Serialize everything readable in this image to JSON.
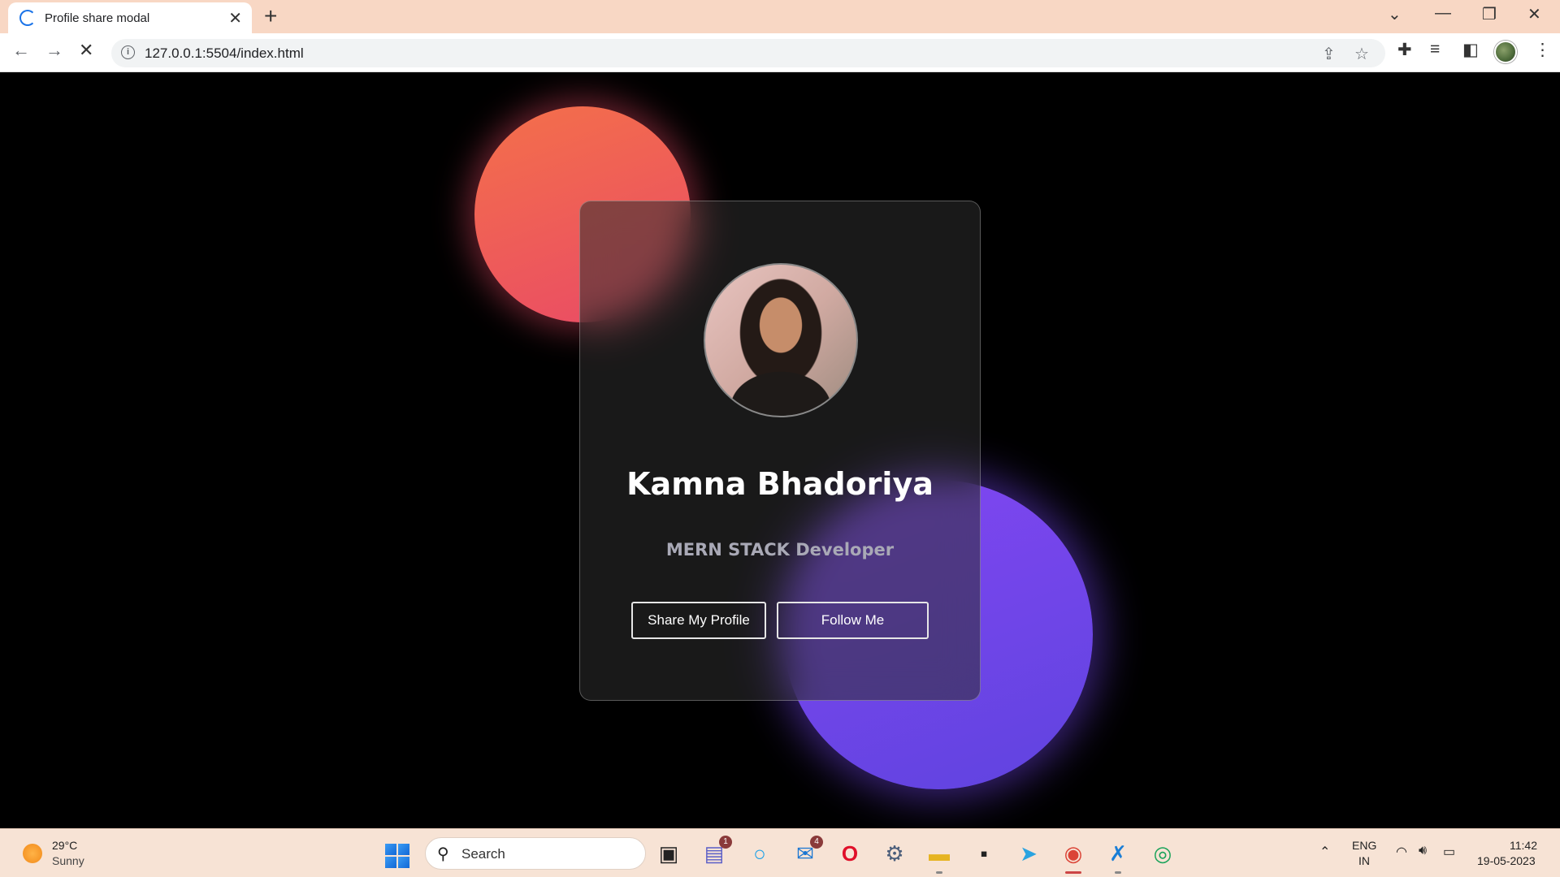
{
  "browser": {
    "tab_title": "Profile share modal",
    "url": "127.0.0.1:5504/index.html"
  },
  "profile": {
    "name": "Kamna Bhadoriya",
    "role": "MERN STACK Developer",
    "share_label": "Share My Profile",
    "follow_label": "Follow Me"
  },
  "colors": {
    "red_blob": "#f06050",
    "purple_blob": "#7046ea",
    "page_bg": "#000000"
  },
  "taskbar": {
    "temperature": "29°C",
    "condition": "Sunny",
    "search_placeholder": "Search",
    "chat_badge": "1",
    "mail_badge": "4",
    "lang_top": "ENG",
    "lang_bottom": "IN",
    "time": "11:42",
    "date": "19-05-2023"
  }
}
